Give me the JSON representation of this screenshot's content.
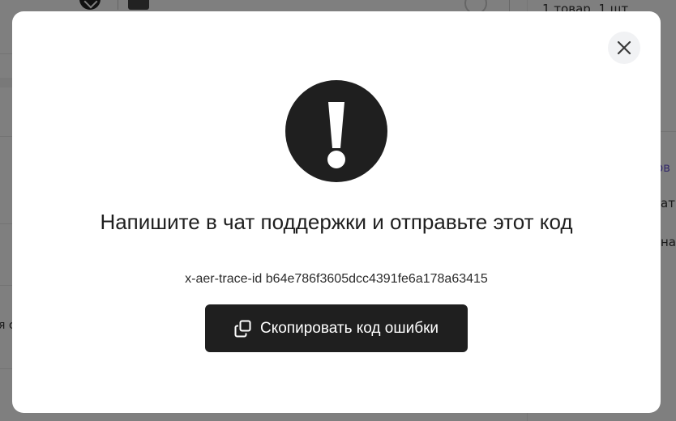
{
  "background": {
    "cart_summary": "1 товар, 1 шт",
    "right_link_fragment": "ов",
    "right_text_1_fragment": "ат",
    "right_text_2_fragment": "на",
    "left_text_fragment": "я с"
  },
  "modal": {
    "icon": "exclamation-circle-icon",
    "title": "Напишите в чат поддержки и отправьте этот код",
    "trace_label": "x-aer-trace-id",
    "trace_id": "b64e786f3605dcc4391fe6a178a63415",
    "copy_button_label": "Скопировать код ошибки",
    "copy_icon": "copy-icon",
    "close_icon": "close-icon"
  },
  "colors": {
    "overlay": "#000000",
    "modal_bg": "#ffffff",
    "button_bg": "#1f1f1f",
    "button_text": "#ffffff",
    "close_bg": "#f1f2f4",
    "icon_fill": "#1f1f1f",
    "link": "#6f5bd6"
  }
}
